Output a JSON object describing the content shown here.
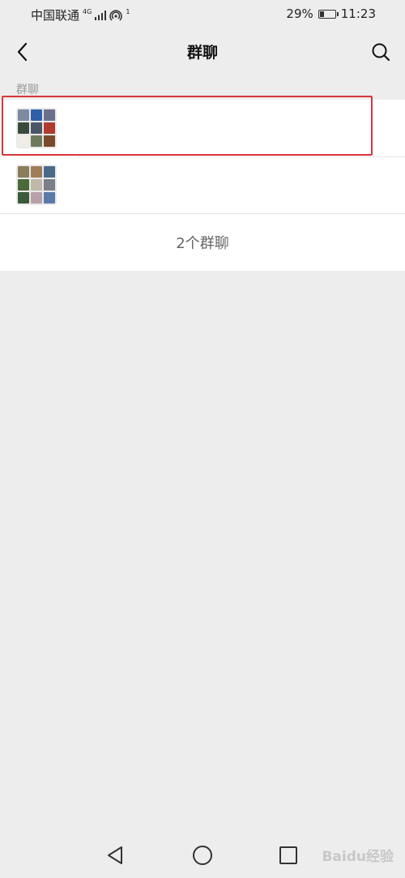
{
  "status_bar": {
    "carrier": "中国联通",
    "network": "4G",
    "hotspot_count": "1",
    "battery_percent": "29%",
    "battery_level": 0.29,
    "time": "11:23"
  },
  "nav": {
    "title": "群聊",
    "back_icon": "chevron-left-icon",
    "search_icon": "search-icon"
  },
  "section_label": "群聊",
  "groups": [
    {
      "name": "",
      "avatar_colors": [
        "#7d8aa0",
        "#2f5fa8",
        "#6c6f8a",
        "#3b4a3a",
        "#4b5568",
        "#b03a2e",
        "#f0ede8",
        "#6d7a5b",
        "#7a4a2a"
      ]
    },
    {
      "name": "",
      "avatar_colors": [
        "#8a7d5a",
        "#a07d5a",
        "#4b6a8a",
        "#4a6a3a",
        "#c0b8a8",
        "#7a7f88",
        "#3a5a3a",
        "#b8a0a8",
        "#5a7aa8"
      ]
    }
  ],
  "group_count_label": "2个群聊",
  "highlight_color": "#d9353b",
  "watermark": "Baidu经验"
}
